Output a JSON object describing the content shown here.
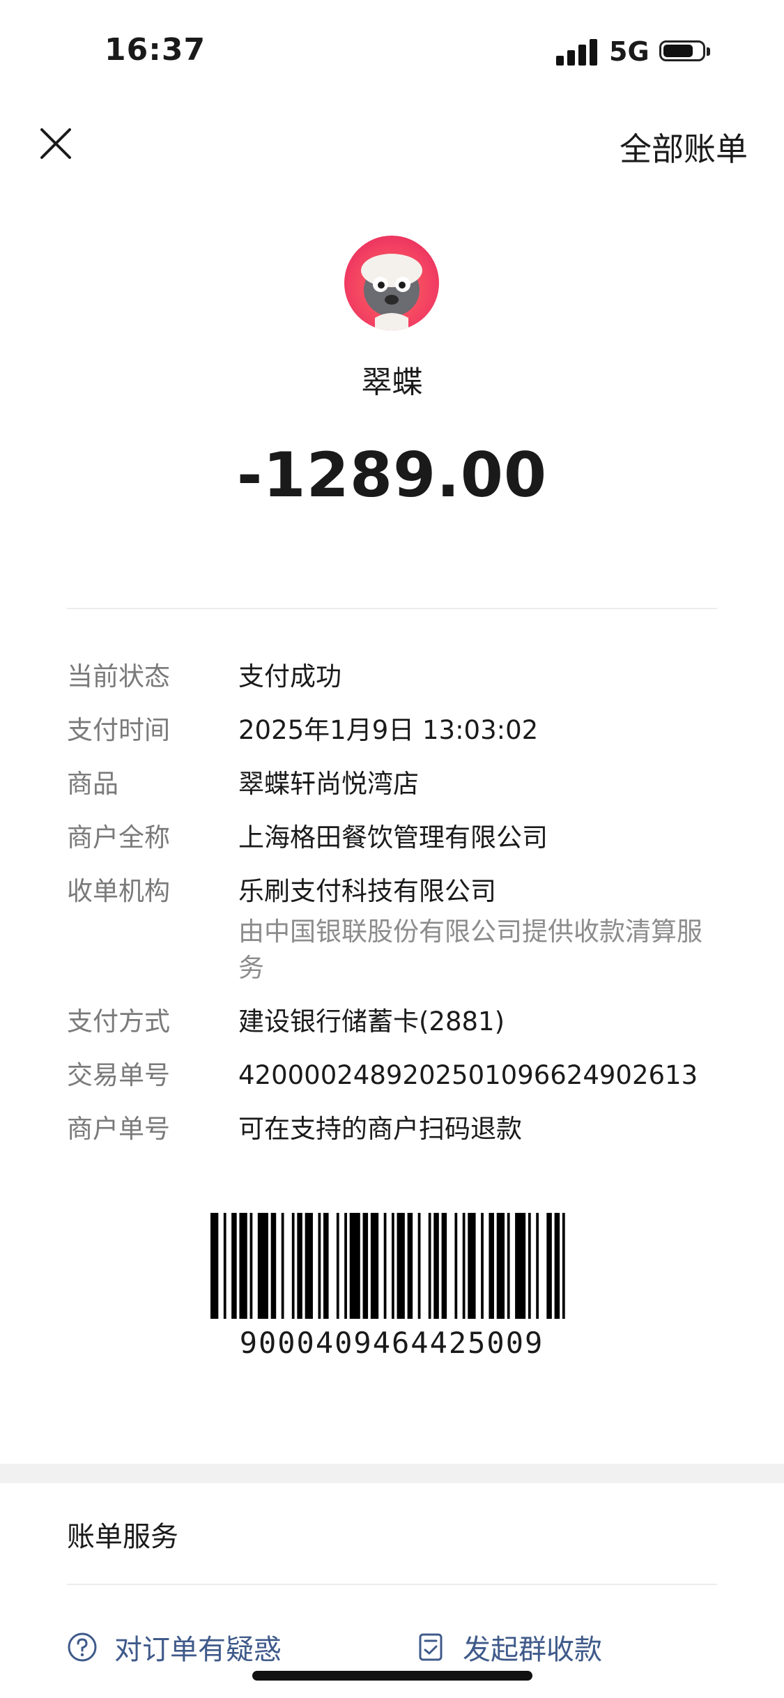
{
  "status_bar": {
    "time": "16:37",
    "network": "5G"
  },
  "nav": {
    "right_action": "全部账单"
  },
  "merchant": {
    "name": "翠蝶",
    "amount": "-1289.00"
  },
  "details": [
    {
      "label": "当前状态",
      "value": "支付成功"
    },
    {
      "label": "支付时间",
      "value": "2025年1月9日 13:03:02"
    },
    {
      "label": "商品",
      "value": "翠蝶轩尚悦湾店"
    },
    {
      "label": "商户全称",
      "value": "上海格田餐饮管理有限公司"
    },
    {
      "label": "收单机构",
      "value": "乐刷支付科技有限公司",
      "sub": "由中国银联股份有限公司提供收款清算服务"
    },
    {
      "label": "支付方式",
      "value": "建设银行储蓄卡(2881)"
    },
    {
      "label": "交易单号",
      "value": "4200002489202501096624902613"
    },
    {
      "label": "商户单号",
      "value": "可在支持的商户扫码退款"
    }
  ],
  "barcode": {
    "number": "9000409464425009"
  },
  "services": {
    "title": "账单服务",
    "actions": [
      {
        "label": "对订单有疑惑",
        "icon": "question-circle-icon"
      },
      {
        "label": "发起群收款",
        "icon": "receipt-check-icon"
      }
    ]
  },
  "colors": {
    "link": "#3f5a8a",
    "label_gray": "#7a7a7a",
    "avatar_red": "#f23f62"
  }
}
